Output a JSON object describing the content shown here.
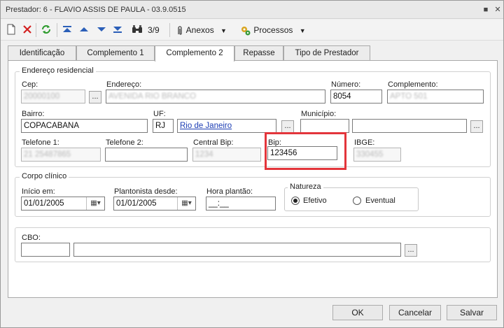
{
  "window": {
    "title": "Prestador: 6 - FLAVIO ASSIS DE PAULA - 03.9.0515",
    "pin_glyph": "■",
    "close_glyph": "✕"
  },
  "toolbar": {
    "record_position": "3/9",
    "anexos_label": "Anexos",
    "processos_label": "Processos"
  },
  "tabs": [
    "Identificação",
    "Complemento 1",
    "Complemento 2",
    "Repasse",
    "Tipo de Prestador"
  ],
  "endereco": {
    "legend": "Endereço residencial",
    "cep_label": "Cep:",
    "cep_value": "20000100",
    "endereco_label": "Endereço:",
    "endereco_value": "AVENIDA RIO BRANCO",
    "numero_label": "Número:",
    "numero_value": "8054",
    "complemento_label": "Complemento:",
    "complemento_value": "APTO 501",
    "bairro_label": "Bairro:",
    "bairro_value": "COPACABANA",
    "uf_label": "UF:",
    "uf_value": "RJ",
    "cidade_value": "Rio de Janeiro",
    "municipio_label": "Município:",
    "municipio_value": "",
    "tel1_label": "Telefone 1:",
    "tel1_value": "21 25487865",
    "tel2_label": "Telefone 2:",
    "tel2_value": "",
    "centralbip_label": "Central Bip:",
    "centralbip_value": "1234",
    "bip_label": "Bip:",
    "bip_value": "123456",
    "ibge_label": "IBGE:",
    "ibge_value": "330455"
  },
  "corpo": {
    "legend": "Corpo clínico",
    "inicio_label": "Início em:",
    "inicio_value": "01/01/2005",
    "plantonista_label": "Plantonista desde:",
    "plantonista_value": "01/01/2005",
    "hora_label": "Hora plantão:",
    "hora_value": "__:__",
    "natureza_legend": "Natureza",
    "efetivo_label": "Efetivo",
    "eventual_label": "Eventual",
    "selected": "Efetivo"
  },
  "cbo": {
    "label": "CBO:",
    "code_value": "",
    "desc_value": ""
  },
  "buttons": {
    "ok": "OK",
    "cancel": "Cancelar",
    "save": "Salvar"
  },
  "colors": {
    "highlight": "#e3353b",
    "link": "#1c3db4"
  }
}
